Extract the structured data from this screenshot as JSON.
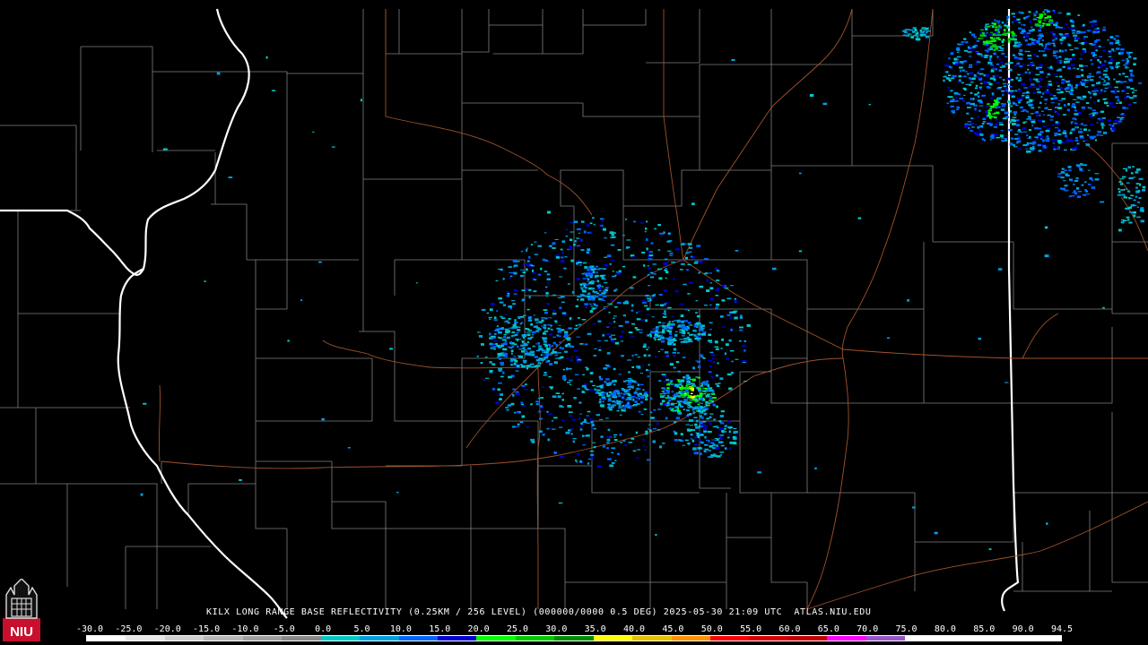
{
  "product": {
    "title": "KILX LONG RANGE BASE REFLECTIVITY (0.25KM / 256 LEVEL) (000000/0000 0.5 DEG) 2025-05-30 21:09 UTC  ATLAS.NIU.EDU"
  },
  "logo": {
    "text": "NIU",
    "icon": "niu-tower-icon",
    "color": "#c8102e"
  },
  "color_scale": {
    "labels": [
      "-30.0",
      "-25.0",
      "-20.0",
      "-15.0",
      "-10.0",
      "-5.0",
      "0.0",
      "5.0",
      "10.0",
      "15.0",
      "20.0",
      "25.0",
      "30.0",
      "35.0",
      "40.0",
      "45.0",
      "50.0",
      "55.0",
      "60.0",
      "65.0",
      "70.0",
      "75.0",
      "80.0",
      "85.0",
      "90.0",
      "94.5"
    ],
    "colors": [
      "#ffffff",
      "#e8e8e8",
      "#d0d0d0",
      "#b8b8b8",
      "#a0a0a0",
      "#888888",
      "#00c8c8",
      "#00a0e0",
      "#0064ff",
      "#0000d0",
      "#00ff00",
      "#00c800",
      "#008c00",
      "#ffff00",
      "#e6c000",
      "#ff9000",
      "#ff0000",
      "#d60000",
      "#c00000",
      "#ff00ff",
      "#9955c9",
      "#ffffff",
      "#ffffff",
      "#ffffff",
      "#ffffff"
    ]
  },
  "map_colors": {
    "state_border": "#ffffff",
    "county_border": "#7f7f7f",
    "highway": "#a0522d",
    "background": "#000000"
  }
}
